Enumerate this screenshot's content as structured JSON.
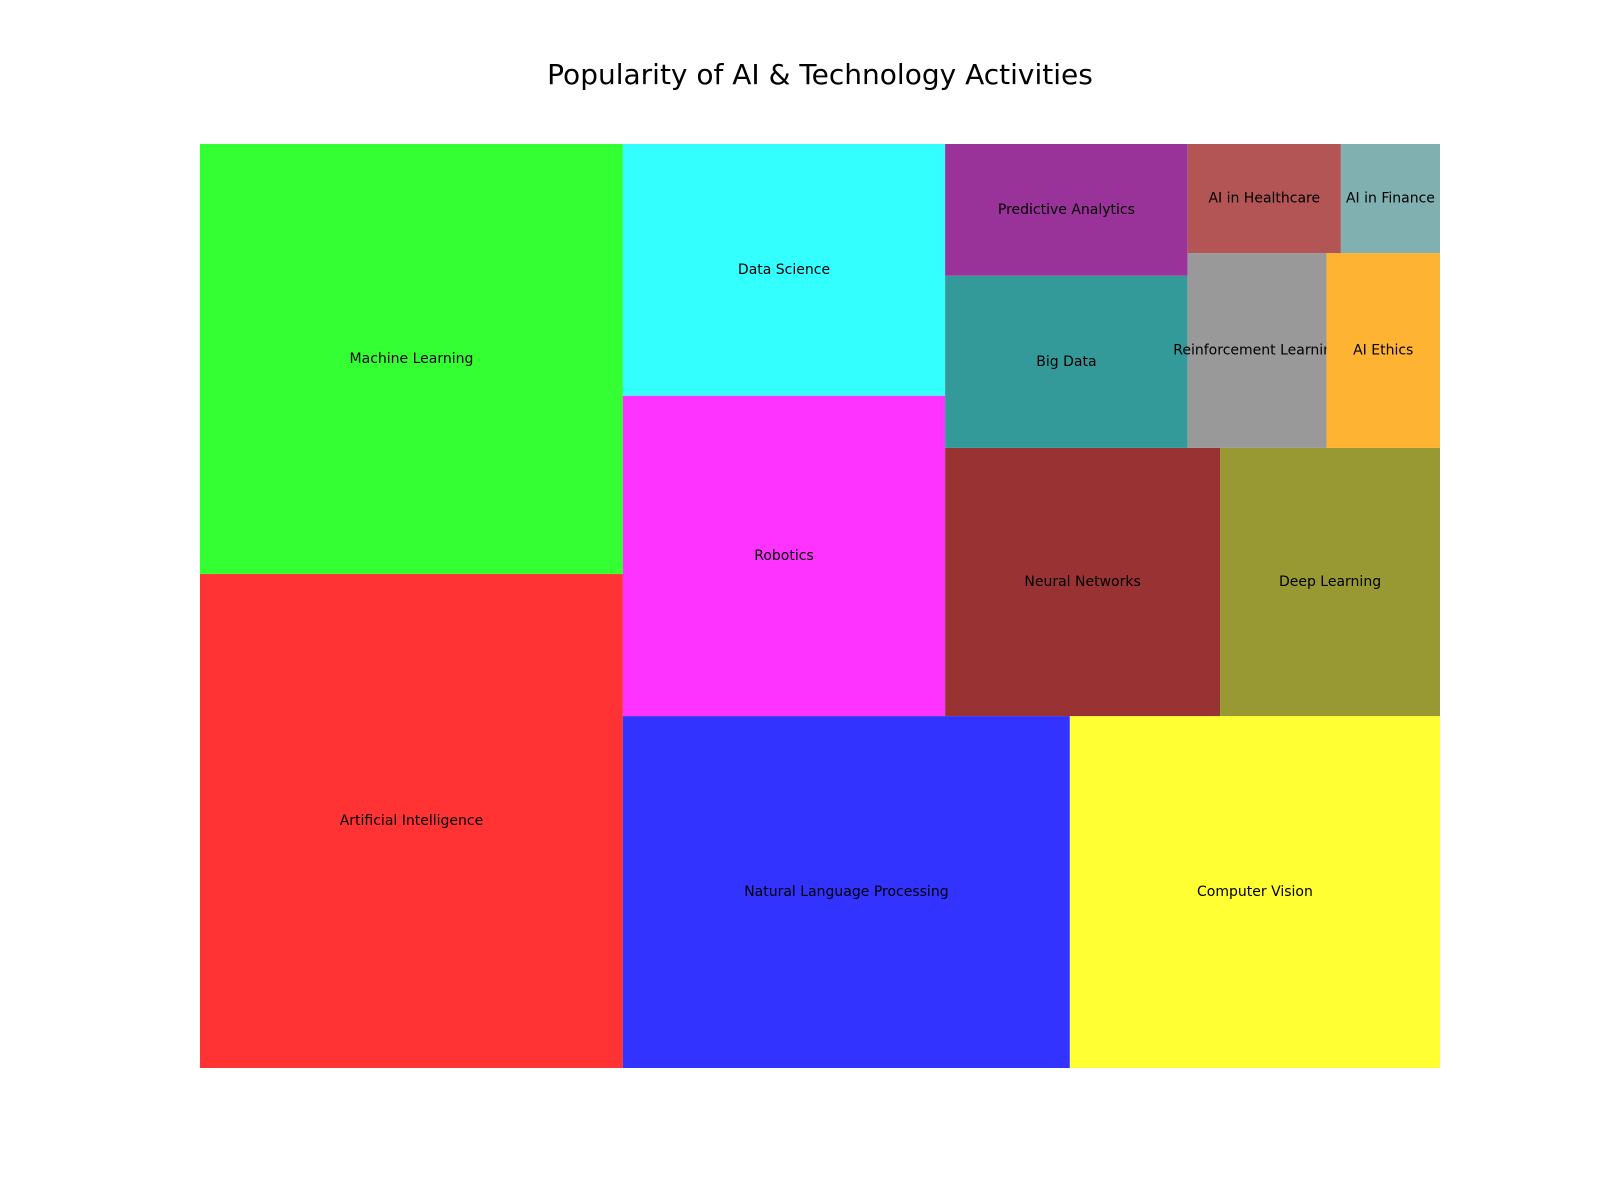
{
  "chart_data": {
    "type": "treemap",
    "title": "Popularity of AI & Technology Activities",
    "items": [
      {
        "label": "Artificial Intelligence",
        "value": 85,
        "color": "#ff3333"
      },
      {
        "label": "Machine Learning",
        "value": 74,
        "color": "#33ff33"
      },
      {
        "label": "Natural Language Processing",
        "value": 64,
        "color": "#3333ff"
      },
      {
        "label": "Computer Vision",
        "value": 53,
        "color": "#ffff33"
      },
      {
        "label": "Robotics",
        "value": 42,
        "color": "#ff33ff"
      },
      {
        "label": "Data Science",
        "value": 33,
        "color": "#33ffff"
      },
      {
        "label": "Neural Networks",
        "value": 30,
        "color": "#993333"
      },
      {
        "label": "Deep Learning",
        "value": 24,
        "color": "#999933"
      },
      {
        "label": "Big Data",
        "value": 17,
        "color": "#339999"
      },
      {
        "label": "Predictive Analytics",
        "value": 13,
        "color": "#993399"
      },
      {
        "label": "Reinforcement Learning",
        "value": 11,
        "color": "#999999"
      },
      {
        "label": "AI Ethics",
        "value": 9,
        "color": "#ffb333"
      },
      {
        "label": "AI in Healthcare",
        "value": 6.8,
        "color": "#b35555"
      },
      {
        "label": "AI in Finance",
        "value": 4.4,
        "color": "#80b0b0"
      }
    ]
  }
}
